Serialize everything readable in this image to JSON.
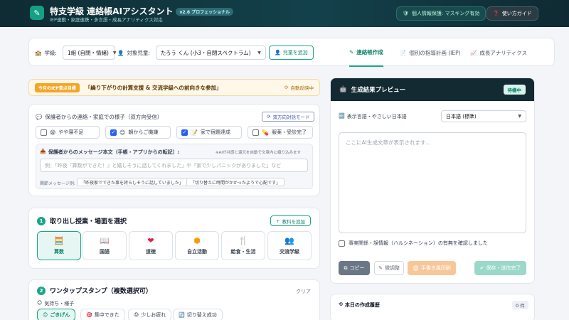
{
  "header": {
    "title": "特支学級 連絡帳AIアシスタント",
    "version": "v2.6 プロフェッショナル",
    "subtitle": "IEP連動・家庭連携・多言語・成長アナリティクス対応",
    "privacy": "個人情報保護: マスキング有効",
    "guide": "使い方ガイド"
  },
  "toolbar": {
    "class_label": "学級:",
    "class_value": "1組 (自閉・情緒)",
    "student_label": "対象児童:",
    "student_value": "たろう くん (小3・自閉スペクトラム)",
    "add_student": "児童を追加",
    "tabs": [
      "連絡帳作成",
      "個別の指導計画 (IEP)",
      "成長アナリティクス"
    ]
  },
  "iep": {
    "tag": "今月のIEP重点目標",
    "goal": "「繰り下がりの計算支援 & 交流学級への前向きな参加」",
    "status": "自動反映中"
  },
  "family": {
    "title": "保護者からの連絡・家庭での様子（双方向受信）",
    "mode_button": "双方向対話モード",
    "checks": [
      {
        "label": "やや寝不足",
        "emoji": "😪",
        "checked": false
      },
      {
        "label": "朝からご機嫌",
        "emoji": "😊",
        "checked": true
      },
      {
        "label": "家で宿題達成",
        "emoji": "📝",
        "checked": true
      },
      {
        "label": "服薬・受診完了",
        "emoji": "💊",
        "checked": false
      }
    ],
    "msg_label": "保護者からのメッセージ本文（手帳・アプリからの転記）:",
    "msg_note": "※AIが共感と還元を自動で文章内に織り込みます",
    "msg_placeholder": "例：「昨夜『算数ができた！』と嬉しそうに話してくれました」や「家で少しパニックがありました」など",
    "examples_label": "関節メッセージ例:",
    "examples": [
      "「昨夜家でできた事を誇らしそうに話していました」",
      "「切り替えに時間がかかったようで心配です」"
    ]
  },
  "subjects": {
    "num": "1",
    "title": "取り出し授業・場面を選択",
    "add": "教科を追加",
    "items": [
      {
        "label": "算数",
        "icon": "calculator-icon",
        "glyph": "🧮",
        "active": true
      },
      {
        "label": "国語",
        "icon": "book-icon",
        "glyph": "📖",
        "active": false
      },
      {
        "label": "道徳",
        "icon": "heart-icon",
        "glyph": "❤",
        "active": false
      },
      {
        "label": "自立活動",
        "icon": "shapes-icon",
        "glyph": "⬢",
        "active": false
      },
      {
        "label": "給食・生活",
        "icon": "utensils-icon",
        "glyph": "🍴",
        "active": false
      },
      {
        "label": "交流学級",
        "icon": "people-icon",
        "glyph": "👥",
        "active": false
      }
    ]
  },
  "stamps": {
    "num": "2",
    "title": "ワンタップスタンプ（複数選択可）",
    "clear": "クリア",
    "group": "気持ち・様子",
    "items": [
      {
        "label": "ごきげん",
        "emoji": "😊",
        "active": true
      },
      {
        "label": "集中できた",
        "emoji": "🎯",
        "active": false
      },
      {
        "label": "少しお疲れ",
        "emoji": "😓",
        "active": false
      },
      {
        "label": "切り替え成功",
        "emoji": "🔄",
        "active": false
      }
    ]
  },
  "preview": {
    "title": "生成結果プレビュー",
    "status": "待機中",
    "lang_label": "表示言語・やさしい日本語",
    "lang_value": "日本語 (標準)",
    "placeholder": "ここにAI生成文章が表示されます...",
    "confirm": "事実関係・誤情報（ハルシネーション）の有無を確認しました",
    "copy": "コピー",
    "adjust": "微調整",
    "print": "手書き風印刷",
    "save": "保存・送信完了"
  },
  "history": {
    "title": "本日の作成履歴",
    "count": "0 件"
  },
  "colors": {
    "accent": "#1aa58a",
    "header": "#0f2b33",
    "warning": "#f5a524"
  }
}
